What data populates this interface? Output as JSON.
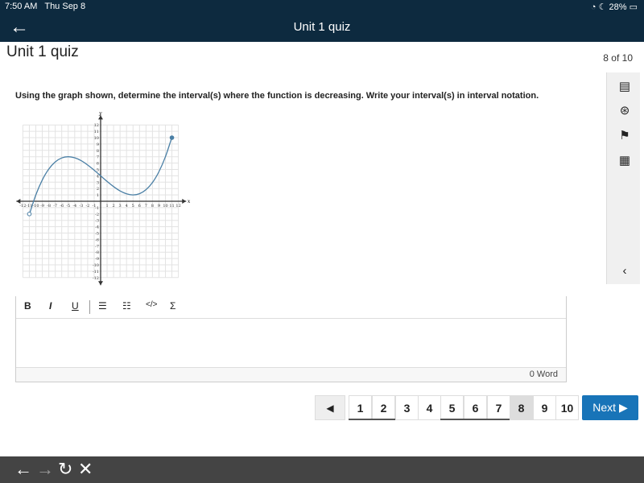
{
  "status": {
    "time": "7:50 AM",
    "date": "Thu Sep 8",
    "battery": "28%"
  },
  "nav": {
    "title": "Unit 1 quiz",
    "back_icon": "←"
  },
  "page": {
    "title": "Unit 1 quiz",
    "counter": "8 of 10"
  },
  "question": "Using the graph shown, determine the interval(s) where the function is decreasing. Write your interval(s) in interval notation.",
  "chart_data": {
    "type": "line",
    "xlabel": "x",
    "ylabel": "y",
    "xlim": [
      -12,
      12
    ],
    "ylim": [
      -12,
      12
    ],
    "grid": true,
    "x_ticks": [
      -12,
      -11,
      -10,
      -9,
      -8,
      -7,
      -6,
      -5,
      -4,
      -3,
      -2,
      -1,
      1,
      2,
      3,
      4,
      5,
      6,
      7,
      8,
      9,
      10,
      11,
      12
    ],
    "y_ticks": [
      -12,
      -11,
      -10,
      -9,
      -8,
      -7,
      -6,
      -5,
      -4,
      -3,
      -2,
      -1,
      1,
      2,
      3,
      4,
      5,
      6,
      7,
      8,
      9,
      10,
      11,
      12
    ],
    "series": [
      {
        "x": [
          -11,
          -10,
          -9,
          -8,
          -7,
          -6,
          -5,
          -4,
          -3,
          -2,
          -1,
          0,
          1,
          2,
          3,
          4,
          5,
          6,
          7,
          8,
          9,
          10,
          11
        ],
        "y": [
          -2.07,
          1,
          3.35,
          5.06,
          6.18,
          6.81,
          7,
          6.83,
          6.38,
          5.7,
          4.89,
          4,
          3.11,
          2.3,
          1.62,
          1.17,
          1,
          1.19,
          1.82,
          2.94,
          4.65,
          7,
          10.07
        ]
      }
    ],
    "endpoints": [
      {
        "x": -11,
        "y": -2,
        "open": true
      },
      {
        "x": 11,
        "y": 10,
        "open": false
      }
    ],
    "color": "#4a7fa5"
  },
  "editor": {
    "bold": "B",
    "italic": "I",
    "underline": "U",
    "bullets": "☰",
    "numbered": "☷",
    "code": "</>",
    "sigma": "Σ",
    "word_count": "0 Word"
  },
  "pager": {
    "pages": [
      "1",
      "2",
      "3",
      "4",
      "5",
      "6",
      "7",
      "8",
      "9",
      "10"
    ],
    "current": "8",
    "next": "Next ▶",
    "prev": "◀"
  },
  "browser": {
    "back": "←",
    "forward": "→",
    "reload": "↻",
    "close": "✕"
  }
}
